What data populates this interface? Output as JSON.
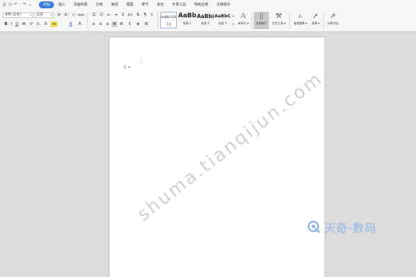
{
  "menubar": {
    "quick_access": [
      "⎙",
      "◷",
      "↶",
      "·",
      "↷",
      "⌄"
    ],
    "tabs": [
      {
        "label": "开始",
        "active": true
      },
      {
        "label": "插入"
      },
      {
        "label": "页面布局"
      },
      {
        "label": "引用"
      },
      {
        "label": "审阅"
      },
      {
        "label": "视图"
      },
      {
        "label": "章节"
      },
      {
        "label": "安全"
      },
      {
        "label": "开发工具"
      },
      {
        "label": "特色应用"
      },
      {
        "label": "文档助手"
      }
    ]
  },
  "ribbon": {
    "font_family": "宋体 (正文)",
    "font_size": "五号",
    "row1_font_icons": [
      "A⁺",
      "A⁻",
      "◇",
      "wén"
    ],
    "row2_font_icons": [
      "B",
      "I",
      "U",
      "A",
      "X²",
      "X₂",
      "A",
      "ab",
      "A",
      "A"
    ],
    "para_row1_icons": [
      "☰",
      "☷",
      "⇤",
      "⇥",
      "↕",
      "A↕",
      "⇅",
      "¶",
      "⇳"
    ],
    "para_row2_icons": [
      "≡",
      "≡",
      "≡",
      "≣",
      "≣",
      "⇕",
      "◈",
      "⊞"
    ],
    "styles": [
      {
        "sample": "AaBbCcDd",
        "name": "正文"
      },
      {
        "sample": "AaBb",
        "name": "标题 1"
      },
      {
        "sample": "AaBb(",
        "name": "标题 2"
      },
      {
        "sample": "AaBbC",
        "name": "标题 3"
      }
    ],
    "buttons": {
      "new_style": "新样式 ▾",
      "doc_assistant": "文档助手",
      "text_tools": "文字工具 ▾",
      "find_replace": "查找替换 ▾",
      "select": "选择 ▾",
      "share_doc": "分享文档"
    }
  },
  "document": {
    "para_mark": "⎘ ▾"
  },
  "watermark": {
    "url": "shuma.tianqijun.com",
    "brand": "天奇·数码"
  },
  "colors": {
    "accent": "#3b7ddd",
    "watermark_text": "#aaaaaa",
    "logo": "#8fb3e6"
  }
}
